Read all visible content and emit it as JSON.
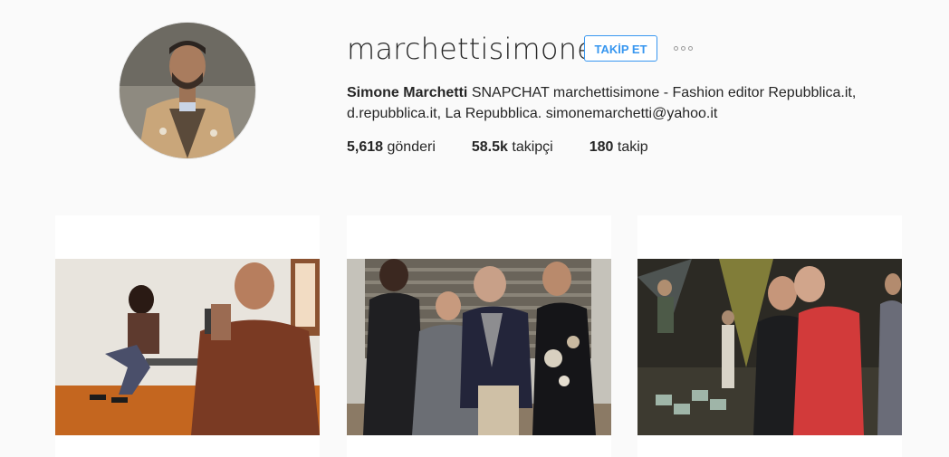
{
  "profile": {
    "username": "marchettisimone",
    "follow_label": "TAKİP ET",
    "full_name": "Simone Marchetti",
    "bio_line_1": "SNAPCHAT marchettisimone - Fashion editor Repubblica.it,",
    "bio_line_2": "d.repubblica.it, La Repubblica. simonemarchetti@yahoo.it",
    "stats": {
      "posts_count": "5,618",
      "posts_label": "gönderi",
      "followers_count": "58.5k",
      "followers_label": "takipçi",
      "following_count": "180",
      "following_label": "takip"
    }
  },
  "colors": {
    "accent": "#3897f0",
    "background": "#fafafa"
  },
  "icons": {
    "more": "more-options-icon"
  }
}
